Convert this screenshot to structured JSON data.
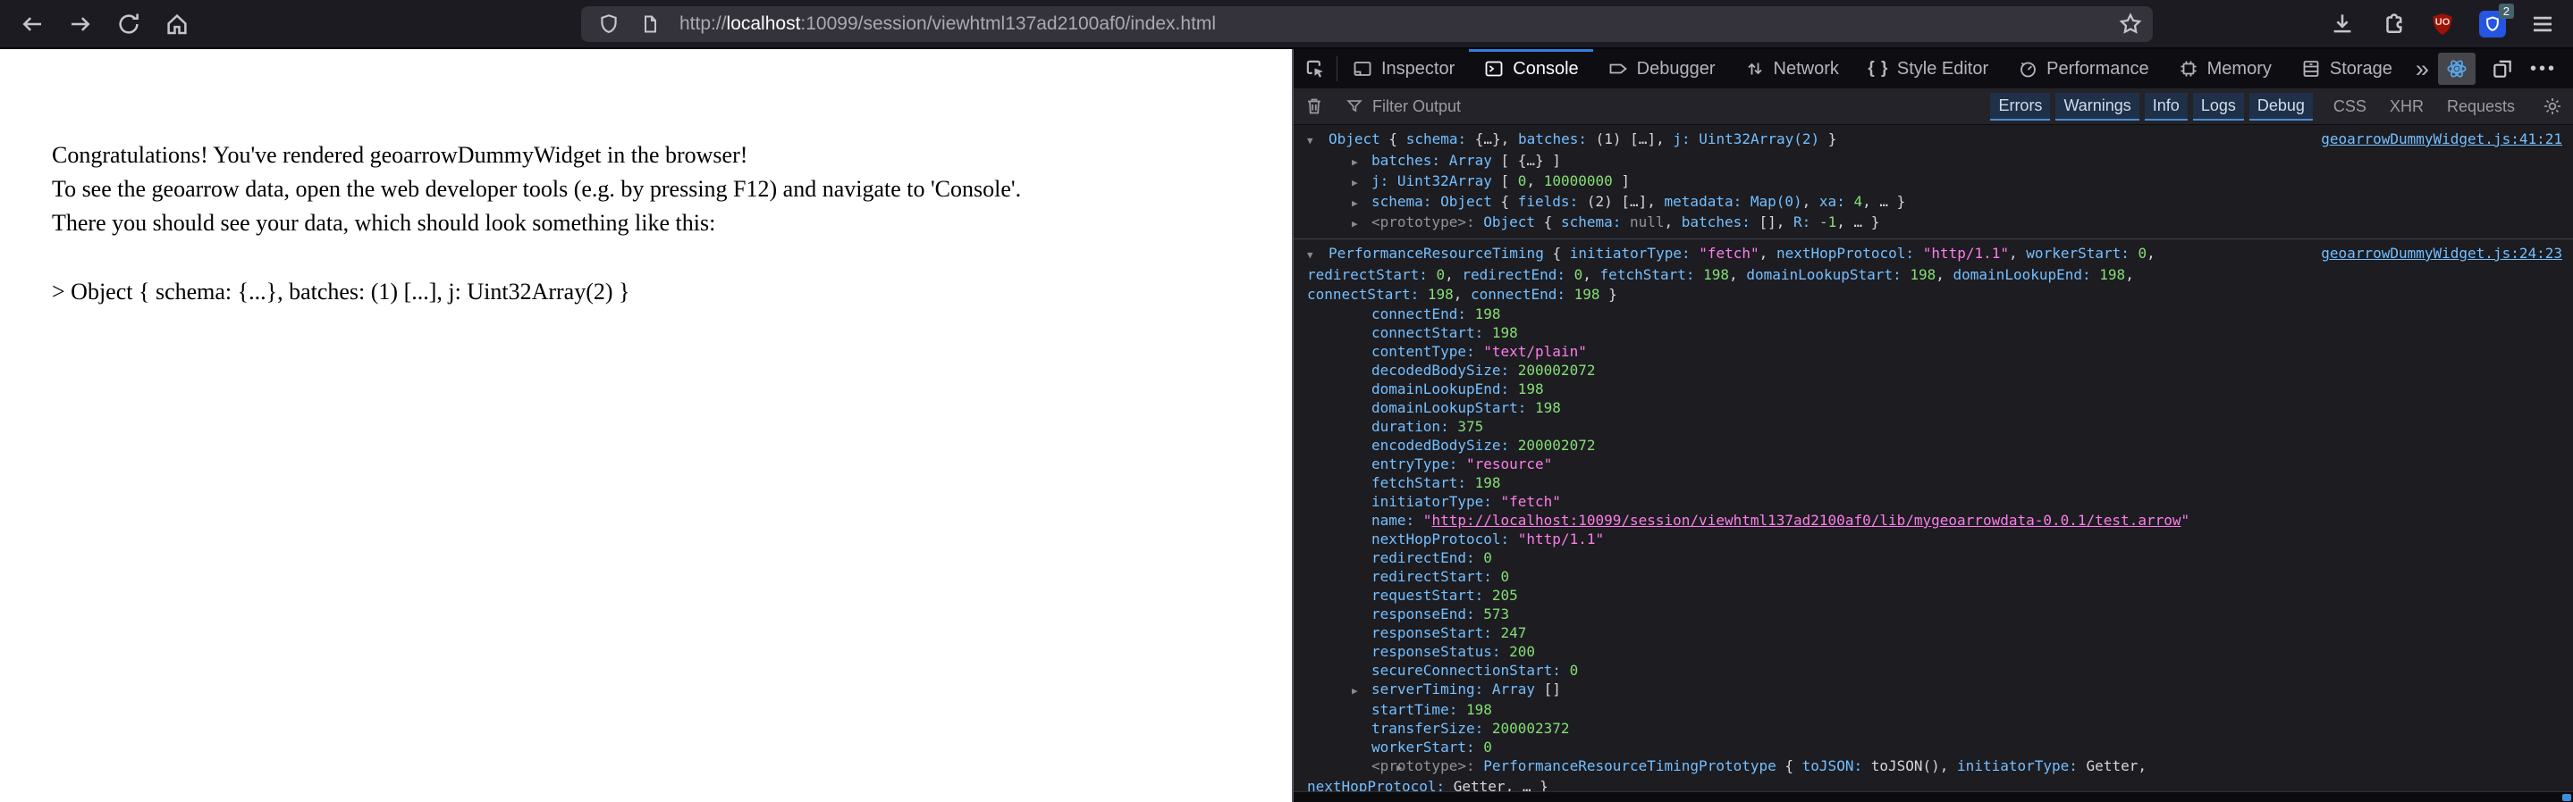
{
  "browser": {
    "url": {
      "scheme": "http://",
      "host": "localhost",
      "rest": ":10099/session/viewhtml137ad2100af0/index.html"
    },
    "ublock_text": "UO",
    "bitwarden_badge": "2"
  },
  "page": {
    "lines": [
      "Congratulations! You've rendered geoarrowDummyWidget in the browser!",
      "To see the geoarrow data, open the web developer tools (e.g. by pressing F12) and navigate to 'Console'.",
      "There you should see your data, which should look something like this:"
    ],
    "sample": "> Object { schema: {...}, batches: (1) [...], j: Uint32Array(2) }"
  },
  "devtools": {
    "tabs": [
      {
        "label": "Inspector",
        "icon": "inspector-icon"
      },
      {
        "label": "Console",
        "icon": "console-icon"
      },
      {
        "label": "Debugger",
        "icon": "debugger-icon"
      },
      {
        "label": "Network",
        "icon": "network-icon"
      },
      {
        "label": "Style Editor",
        "icon": "style-editor-icon"
      },
      {
        "label": "Performance",
        "icon": "performance-icon"
      },
      {
        "label": "Memory",
        "icon": "memory-icon"
      },
      {
        "label": "Storage",
        "icon": "storage-icon"
      }
    ],
    "active_tab": "Console",
    "filter": {
      "placeholder": "Filter Output",
      "levels": [
        "Errors",
        "Warnings",
        "Info",
        "Logs",
        "Debug"
      ],
      "types": [
        "CSS",
        "XHR",
        "Requests"
      ]
    },
    "console": {
      "entries": [
        {
          "source": "geoarrowDummyWidget.js:41:21",
          "preview": [
            {
              "t": "c",
              "v": "Object"
            },
            {
              "t": "d",
              "v": " { "
            },
            {
              "t": "k",
              "v": "schema: "
            },
            {
              "t": "d",
              "v": "{…}, "
            },
            {
              "t": "k",
              "v": "batches: "
            },
            {
              "t": "d",
              "v": "(1) […], "
            },
            {
              "t": "k",
              "v": "j: "
            },
            {
              "t": "c",
              "v": "Uint32Array(2)"
            },
            {
              "t": "d",
              "v": " }"
            }
          ],
          "children": [
            {
              "arrow": true,
              "tokens": [
                {
                  "t": "k",
                  "v": "batches: "
                },
                {
                  "t": "c",
                  "v": "Array"
                },
                {
                  "t": "d",
                  "v": " [ {…} ]"
                }
              ]
            },
            {
              "arrow": true,
              "tokens": [
                {
                  "t": "k",
                  "v": "j: "
                },
                {
                  "t": "c",
                  "v": "Uint32Array"
                },
                {
                  "t": "d",
                  "v": " [ "
                },
                {
                  "t": "n",
                  "v": "0"
                },
                {
                  "t": "d",
                  "v": ", "
                },
                {
                  "t": "n",
                  "v": "10000000"
                },
                {
                  "t": "d",
                  "v": " ]"
                }
              ]
            },
            {
              "arrow": true,
              "tokens": [
                {
                  "t": "k",
                  "v": "schema: "
                },
                {
                  "t": "c",
                  "v": "Object"
                },
                {
                  "t": "d",
                  "v": " { "
                },
                {
                  "t": "k",
                  "v": "fields: "
                },
                {
                  "t": "d",
                  "v": "(2) […], "
                },
                {
                  "t": "k",
                  "v": "metadata: "
                },
                {
                  "t": "c",
                  "v": "Map(0)"
                },
                {
                  "t": "d",
                  "v": ", "
                },
                {
                  "t": "k",
                  "v": "xa: "
                },
                {
                  "t": "n",
                  "v": "4"
                },
                {
                  "t": "d",
                  "v": ", … }"
                }
              ]
            },
            {
              "arrow": true,
              "tokens": [
                {
                  "t": "g",
                  "v": "<prototype>: "
                },
                {
                  "t": "c",
                  "v": "Object"
                },
                {
                  "t": "d",
                  "v": " { "
                },
                {
                  "t": "k",
                  "v": "schema: "
                },
                {
                  "t": "g",
                  "v": "null"
                },
                {
                  "t": "d",
                  "v": ", "
                },
                {
                  "t": "k",
                  "v": "batches: "
                },
                {
                  "t": "d",
                  "v": "[], "
                },
                {
                  "t": "k",
                  "v": "R: "
                },
                {
                  "t": "n",
                  "v": "-1"
                },
                {
                  "t": "d",
                  "v": ", … }"
                }
              ]
            }
          ]
        },
        {
          "source": "geoarrowDummyWidget.js:24:23",
          "preview": [
            {
              "t": "c",
              "v": "PerformanceResourceTiming"
            },
            {
              "t": "d",
              "v": " { "
            },
            {
              "t": "k",
              "v": "initiatorType: "
            },
            {
              "t": "s",
              "v": "\"fetch\""
            },
            {
              "t": "d",
              "v": ", "
            },
            {
              "t": "k",
              "v": "nextHopProtocol: "
            },
            {
              "t": "s",
              "v": "\"http/1.1\""
            },
            {
              "t": "d",
              "v": ", "
            },
            {
              "t": "k",
              "v": "workerStart: "
            },
            {
              "t": "n",
              "v": "0"
            },
            {
              "t": "d",
              "v": ","
            },
            {
              "t": "b"
            },
            {
              "t": "k",
              "v": "redirectStart: "
            },
            {
              "t": "n",
              "v": "0"
            },
            {
              "t": "d",
              "v": ", "
            },
            {
              "t": "k",
              "v": "redirectEnd: "
            },
            {
              "t": "n",
              "v": "0"
            },
            {
              "t": "d",
              "v": ", "
            },
            {
              "t": "k",
              "v": "fetchStart: "
            },
            {
              "t": "n",
              "v": "198"
            },
            {
              "t": "d",
              "v": ", "
            },
            {
              "t": "k",
              "v": "domainLookupStart: "
            },
            {
              "t": "n",
              "v": "198"
            },
            {
              "t": "d",
              "v": ", "
            },
            {
              "t": "k",
              "v": "domainLookupEnd: "
            },
            {
              "t": "n",
              "v": "198"
            },
            {
              "t": "d",
              "v": ","
            },
            {
              "t": "b"
            },
            {
              "t": "k",
              "v": "connectStart: "
            },
            {
              "t": "n",
              "v": "198"
            },
            {
              "t": "d",
              "v": ", "
            },
            {
              "t": "k",
              "v": "connectEnd: "
            },
            {
              "t": "n",
              "v": "198"
            },
            {
              "t": "d",
              "v": " }"
            }
          ],
          "children": [
            {
              "arrow": false,
              "tokens": [
                {
                  "t": "k",
                  "v": "connectEnd: "
                },
                {
                  "t": "n",
                  "v": "198"
                }
              ]
            },
            {
              "arrow": false,
              "tokens": [
                {
                  "t": "k",
                  "v": "connectStart: "
                },
                {
                  "t": "n",
                  "v": "198"
                }
              ]
            },
            {
              "arrow": false,
              "tokens": [
                {
                  "t": "k",
                  "v": "contentType: "
                },
                {
                  "t": "s",
                  "v": "\"text/plain\""
                }
              ]
            },
            {
              "arrow": false,
              "tokens": [
                {
                  "t": "k",
                  "v": "decodedBodySize: "
                },
                {
                  "t": "n",
                  "v": "200002072"
                }
              ]
            },
            {
              "arrow": false,
              "tokens": [
                {
                  "t": "k",
                  "v": "domainLookupEnd: "
                },
                {
                  "t": "n",
                  "v": "198"
                }
              ]
            },
            {
              "arrow": false,
              "tokens": [
                {
                  "t": "k",
                  "v": "domainLookupStart: "
                },
                {
                  "t": "n",
                  "v": "198"
                }
              ]
            },
            {
              "arrow": false,
              "tokens": [
                {
                  "t": "k",
                  "v": "duration: "
                },
                {
                  "t": "n",
                  "v": "375"
                }
              ]
            },
            {
              "arrow": false,
              "tokens": [
                {
                  "t": "k",
                  "v": "encodedBodySize: "
                },
                {
                  "t": "n",
                  "v": "200002072"
                }
              ]
            },
            {
              "arrow": false,
              "tokens": [
                {
                  "t": "k",
                  "v": "entryType: "
                },
                {
                  "t": "s",
                  "v": "\"resource\""
                }
              ]
            },
            {
              "arrow": false,
              "tokens": [
                {
                  "t": "k",
                  "v": "fetchStart: "
                },
                {
                  "t": "n",
                  "v": "198"
                }
              ]
            },
            {
              "arrow": false,
              "tokens": [
                {
                  "t": "k",
                  "v": "initiatorType: "
                },
                {
                  "t": "s",
                  "v": "\"fetch\""
                }
              ]
            },
            {
              "arrow": false,
              "tokens": [
                {
                  "t": "k",
                  "v": "name: "
                },
                {
                  "t": "s",
                  "v": "\""
                },
                {
                  "t": "sl",
                  "v": "http://localhost:10099/session/viewhtml137ad2100af0/lib/mygeoarrowdata-0.0.1/test.arrow"
                },
                {
                  "t": "s",
                  "v": "\""
                }
              ]
            },
            {
              "arrow": false,
              "tokens": [
                {
                  "t": "k",
                  "v": "nextHopProtocol: "
                },
                {
                  "t": "s",
                  "v": "\"http/1.1\""
                }
              ]
            },
            {
              "arrow": false,
              "tokens": [
                {
                  "t": "k",
                  "v": "redirectEnd: "
                },
                {
                  "t": "n",
                  "v": "0"
                }
              ]
            },
            {
              "arrow": false,
              "tokens": [
                {
                  "t": "k",
                  "v": "redirectStart: "
                },
                {
                  "t": "n",
                  "v": "0"
                }
              ]
            },
            {
              "arrow": false,
              "tokens": [
                {
                  "t": "k",
                  "v": "requestStart: "
                },
                {
                  "t": "n",
                  "v": "205"
                }
              ]
            },
            {
              "arrow": false,
              "tokens": [
                {
                  "t": "k",
                  "v": "responseEnd: "
                },
                {
                  "t": "n",
                  "v": "573"
                }
              ]
            },
            {
              "arrow": false,
              "tokens": [
                {
                  "t": "k",
                  "v": "responseStart: "
                },
                {
                  "t": "n",
                  "v": "247"
                }
              ]
            },
            {
              "arrow": false,
              "tokens": [
                {
                  "t": "k",
                  "v": "responseStatus: "
                },
                {
                  "t": "n",
                  "v": "200"
                }
              ]
            },
            {
              "arrow": false,
              "tokens": [
                {
                  "t": "k",
                  "v": "secureConnectionStart: "
                },
                {
                  "t": "n",
                  "v": "0"
                }
              ]
            },
            {
              "arrow": true,
              "tokens": [
                {
                  "t": "k",
                  "v": "serverTiming: "
                },
                {
                  "t": "c",
                  "v": "Array"
                },
                {
                  "t": "d",
                  "v": " []"
                }
              ]
            },
            {
              "arrow": false,
              "tokens": [
                {
                  "t": "k",
                  "v": "startTime: "
                },
                {
                  "t": "n",
                  "v": "198"
                }
              ]
            },
            {
              "arrow": false,
              "tokens": [
                {
                  "t": "k",
                  "v": "transferSize: "
                },
                {
                  "t": "n",
                  "v": "200002372"
                }
              ]
            },
            {
              "arrow": false,
              "tokens": [
                {
                  "t": "k",
                  "v": "workerStart: "
                },
                {
                  "t": "n",
                  "v": "0"
                }
              ]
            },
            {
              "arrow": true,
              "wrap": true,
              "tokens": [
                {
                  "t": "g",
                  "v": "<prototype>: "
                },
                {
                  "t": "c",
                  "v": "PerformanceResourceTimingPrototype"
                },
                {
                  "t": "d",
                  "v": " { "
                },
                {
                  "t": "k",
                  "v": "toJSON: "
                },
                {
                  "t": "d",
                  "v": "toJSON(), "
                },
                {
                  "t": "k",
                  "v": "initiatorType: "
                },
                {
                  "t": "d",
                  "v": "Getter,"
                },
                {
                  "t": "b"
                },
                {
                  "t": "k",
                  "v": "nextHopProtocol: "
                },
                {
                  "t": "d",
                  "v": "Getter, … }"
                }
              ]
            }
          ]
        }
      ]
    }
  }
}
